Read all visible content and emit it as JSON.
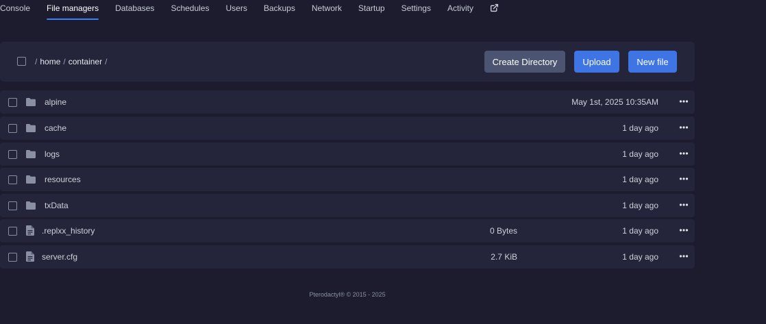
{
  "nav": {
    "tabs": [
      {
        "label": "Console",
        "active": false
      },
      {
        "label": "File managers",
        "active": true
      },
      {
        "label": "Databases",
        "active": false
      },
      {
        "label": "Schedules",
        "active": false
      },
      {
        "label": "Users",
        "active": false
      },
      {
        "label": "Backups",
        "active": false
      },
      {
        "label": "Network",
        "active": false
      },
      {
        "label": "Startup",
        "active": false
      },
      {
        "label": "Settings",
        "active": false
      },
      {
        "label": "Activity",
        "active": false
      }
    ],
    "external_icon": "external-link-icon"
  },
  "toolbar": {
    "breadcrumb": {
      "separator": "/",
      "parts": [
        "home",
        "container"
      ]
    },
    "create_directory_label": "Create Directory",
    "upload_label": "Upload",
    "new_file_label": "New file"
  },
  "files": [
    {
      "name": "alpine",
      "type": "folder",
      "icon": "folder-icon",
      "size": "",
      "modified": "May 1st, 2025 10:35AM"
    },
    {
      "name": "cache",
      "type": "folder",
      "icon": "folder-icon",
      "size": "",
      "modified": "1 day ago"
    },
    {
      "name": "logs",
      "type": "folder",
      "icon": "folder-icon",
      "size": "",
      "modified": "1 day ago"
    },
    {
      "name": "resources",
      "type": "folder",
      "icon": "folder-icon",
      "size": "",
      "modified": "1 day ago"
    },
    {
      "name": "txData",
      "type": "folder",
      "icon": "folder-icon",
      "size": "",
      "modified": "1 day ago"
    },
    {
      "name": ".replxx_history",
      "type": "file",
      "icon": "file-text-icon",
      "size": "0 Bytes",
      "modified": "1 day ago"
    },
    {
      "name": "server.cfg",
      "type": "file",
      "icon": "file-text-icon",
      "size": "2.7 KiB",
      "modified": "1 day ago"
    }
  ],
  "footer": {
    "text": "Pterodactyl® © 2015 - 2025"
  },
  "colors": {
    "background": "#1c1c2e",
    "panel": "#24243a",
    "accent": "#3f74e4",
    "button_gray": "#4b5572",
    "active_tab_underline": "#3b82f6"
  }
}
